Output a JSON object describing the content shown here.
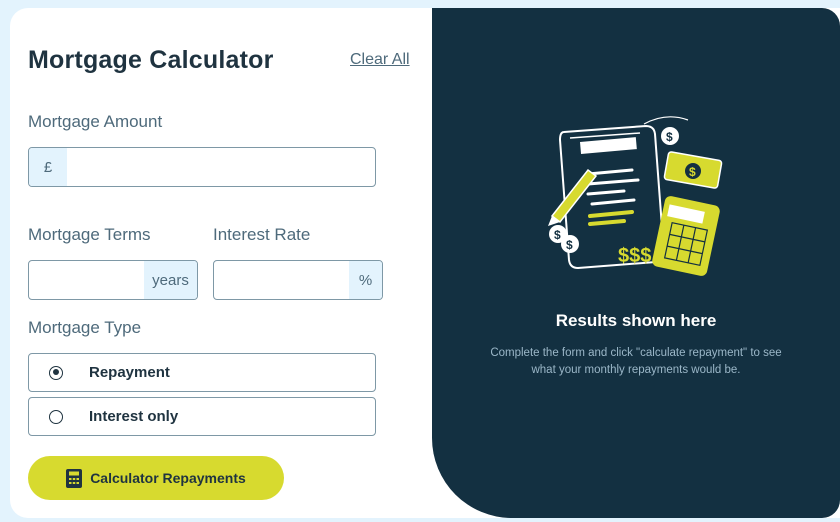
{
  "calculator": {
    "title": "Mortgage Calculator",
    "clear_label": "Clear All",
    "amount": {
      "label": "Mortgage Amount",
      "prefix": "£",
      "value": ""
    },
    "term": {
      "label": "Mortgage Terms",
      "suffix": "years",
      "value": ""
    },
    "rate": {
      "label": "Interest Rate",
      "suffix": "%",
      "value": ""
    },
    "type": {
      "label": "Mortgage Type",
      "options": [
        {
          "label": "Repayment",
          "selected": true
        },
        {
          "label": "Interest only",
          "selected": false
        }
      ]
    },
    "submit_label": "Calculator Repayments",
    "submit_icon": "calculator-icon"
  },
  "results": {
    "title": "Results shown here",
    "description": "Complete the form and click \"calculate repayment\" to see what your monthly repayments would be.",
    "illustration": "empty-results-illustration"
  },
  "colors": {
    "accent": "#d7da2f",
    "dark_panel": "#133041",
    "text": "#1f3340",
    "muted": "#4e6a7b",
    "input_tint": "#e3f3fd"
  }
}
